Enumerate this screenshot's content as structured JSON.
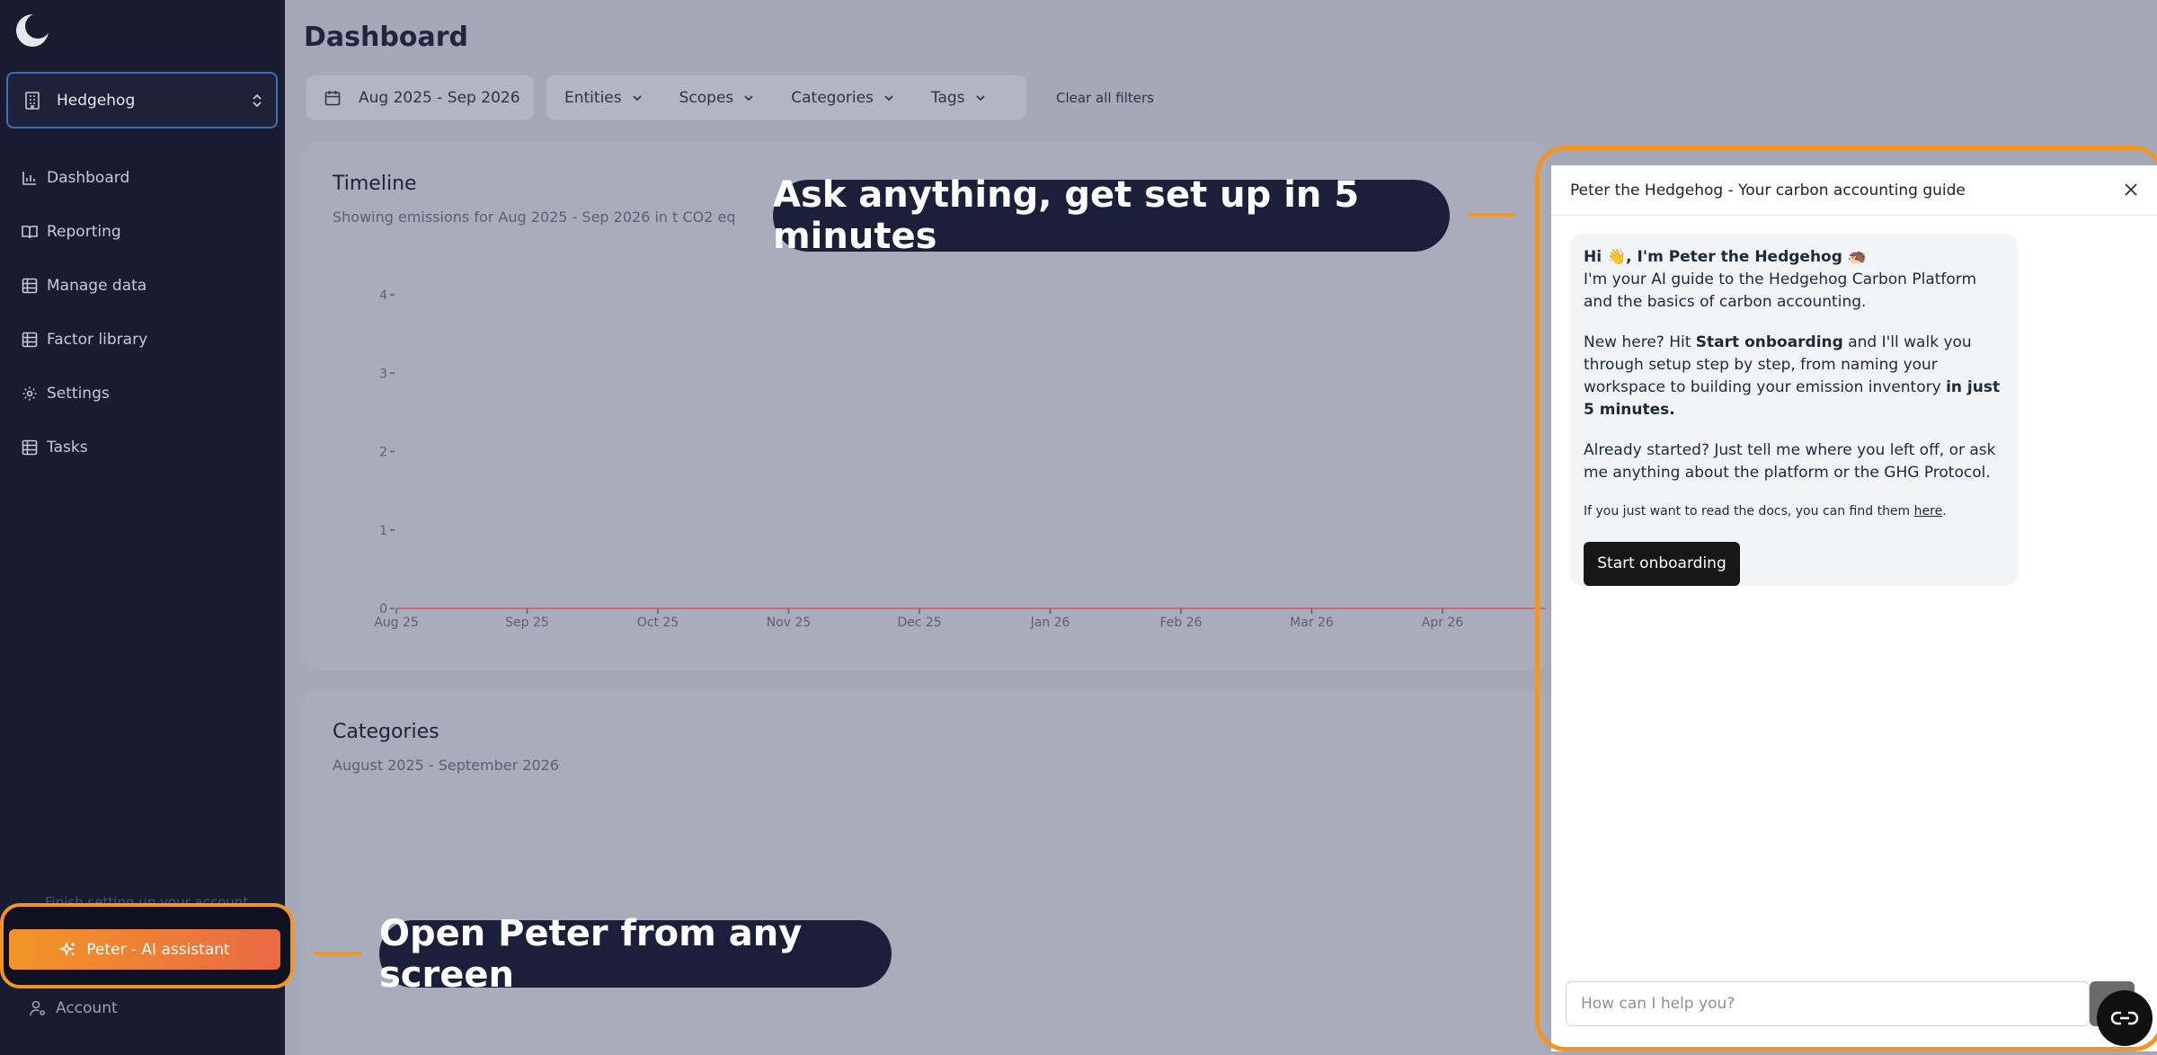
{
  "colors": {
    "accent": "#f29526",
    "sidebar_bg": "#191c31",
    "callout_bg": "#1b1f3a"
  },
  "sidebar": {
    "workspace": "Hedgehog",
    "items": [
      {
        "label": "Dashboard",
        "icon": "bar-chart-icon"
      },
      {
        "label": "Reporting",
        "icon": "book-icon"
      },
      {
        "label": "Manage data",
        "icon": "table-icon"
      },
      {
        "label": "Factor library",
        "icon": "table-icon"
      },
      {
        "label": "Settings",
        "icon": "gear-icon"
      },
      {
        "label": "Tasks",
        "icon": "table-icon"
      }
    ],
    "finish_setup": "Finish setting up your account",
    "peter_button": "Peter - AI assistant",
    "account": "Account"
  },
  "header": {
    "title": "Dashboard"
  },
  "filters": {
    "date_range": "Aug 2025 - Sep 2026",
    "entities": "Entities",
    "scopes": "Scopes",
    "categories": "Categories",
    "tags": "Tags",
    "clear": "Clear all filters"
  },
  "timeline": {
    "title": "Timeline",
    "subtitle": "Showing emissions for Aug 2025 - Sep 2026 in t CO2 eq"
  },
  "chart_data": {
    "type": "line",
    "title": "Timeline",
    "x": [
      "Aug 25",
      "Sep 25",
      "Oct 25",
      "Nov 25",
      "Dec 25",
      "Jan 26",
      "Feb 26",
      "Mar 26",
      "Apr 26"
    ],
    "series": [
      {
        "values": [
          0,
          0,
          0,
          0,
          0,
          0,
          0,
          0,
          0
        ]
      }
    ],
    "y_ticks": [
      0,
      1,
      2,
      3,
      4
    ],
    "ylim": [
      0,
      4
    ],
    "grid": false
  },
  "categories_card": {
    "title": "Categories",
    "subtitle": "August 2025 - September 2026"
  },
  "callouts": {
    "top": "Ask anything, get set up in 5 minutes",
    "bottom": "Open Peter from any screen"
  },
  "chat": {
    "title": "Peter the Hedgehog - Your carbon accounting guide",
    "greeting_hi": "Hi",
    "greeting_wave": "👋",
    "greeting_name": ", I'm Peter the Hedgehog",
    "greeting_hedgehog": "🦔",
    "intro": "I'm your AI guide to the Hedgehog Carbon Platform and the basics of carbon accounting.",
    "new_here_1": "New here? Hit ",
    "new_here_bold": "Start onboarding",
    "new_here_2": " and I'll walk you through setup step by step, from naming your workspace to building your emission inventory ",
    "new_here_bold2": "in just 5 minutes.",
    "already": "Already started? Just tell me where you left off, or ask me anything about the platform or the GHG Protocol.",
    "docs_text": "If you just want to read the docs, you can find them ",
    "docs_link": "here",
    "docs_end": ".",
    "start_button": "Start onboarding",
    "input_placeholder": "How can I help you?"
  }
}
